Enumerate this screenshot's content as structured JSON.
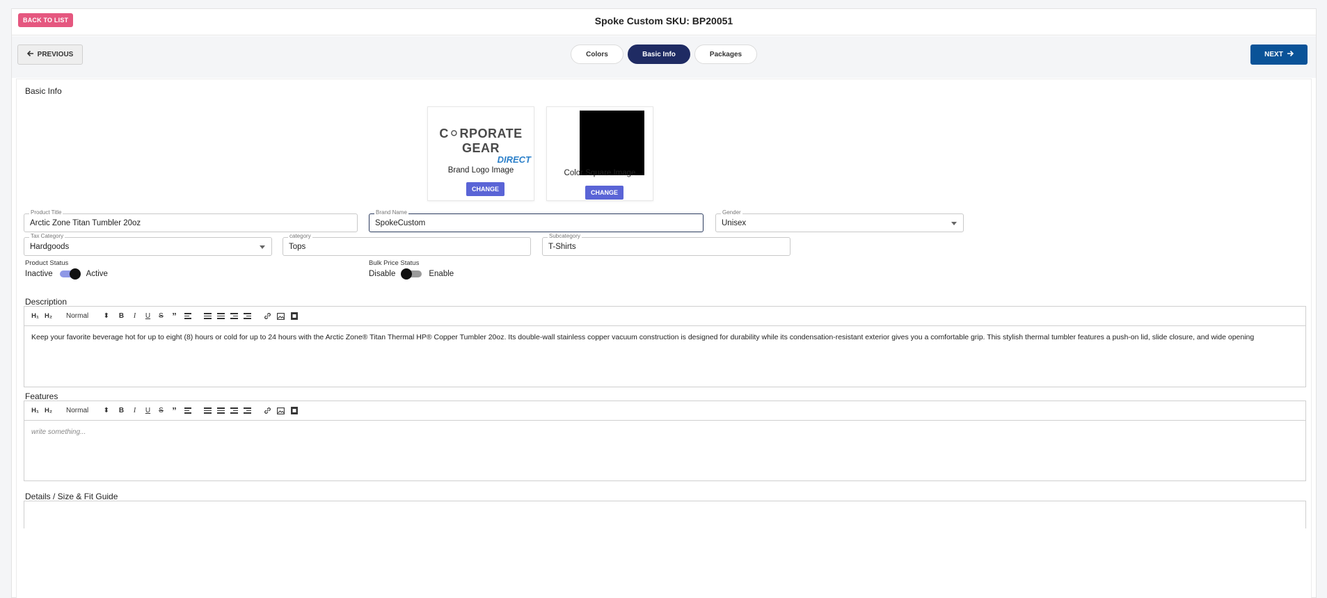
{
  "header": {
    "back_label": "BACK TO LIST",
    "title": "Spoke Custom SKU: BP20051"
  },
  "nav": {
    "previous_label": "PREVIOUS",
    "next_label": "NEXT",
    "tabs": [
      {
        "label": "Colors",
        "active": false
      },
      {
        "label": "Basic Info",
        "active": true
      },
      {
        "label": "Packages",
        "active": false
      }
    ]
  },
  "basic_info": {
    "section_title": "Basic Info",
    "brand_logo": {
      "logo_line1": "C⚪RPORATE GEAR",
      "logo_line2": "DIRECT",
      "caption": "Brand Logo Image",
      "button": "CHANGE"
    },
    "color_square": {
      "swatch_color": "#000000",
      "caption": "Color Square Image",
      "button": "CHANGE"
    },
    "fields": {
      "product_title": {
        "label": "Product Title",
        "value": "Arctic Zone Titan Tumbler 20oz"
      },
      "brand_name": {
        "label": "Brand Name",
        "value": "SpokeCustom"
      },
      "gender": {
        "label": "Gender",
        "value": "Unisex"
      },
      "tax_category": {
        "label": "Tax Category",
        "value": "Hardgoods"
      },
      "category": {
        "label": "category",
        "value": "Tops"
      },
      "subcategory": {
        "label": "Subcategory",
        "value": "T-Shirts"
      }
    },
    "product_status": {
      "label": "Product Status",
      "off_label": "Inactive",
      "on_label": "Active",
      "enabled": true
    },
    "bulk_price_status": {
      "label": "Bulk Price Status",
      "off_label": "Disable",
      "on_label": "Enable",
      "enabled": false
    }
  },
  "editors": {
    "toolbar": {
      "h1": "H₁",
      "h2": "H₂",
      "format": "Normal",
      "bold": "B",
      "italic": "I",
      "underline": "U",
      "strike": "S",
      "quote": "”"
    },
    "description": {
      "label": "Description",
      "text": "Keep your favorite beverage hot for up to eight (8) hours or cold for up to 24 hours with the Arctic Zone® Titan Thermal HP® Copper Tumbler 20oz. Its double-wall stainless copper vacuum construction is designed for durability while its condensation-resistant exterior gives you a comfortable grip. This stylish thermal tumbler features a push-on lid, slide closure, and wide opening"
    },
    "features": {
      "label": "Features",
      "placeholder": "write something..."
    },
    "details": {
      "label": "Details / Size & Fit Guide"
    }
  },
  "colors": {
    "back_button": "#e5577f",
    "next_button": "#0a5398",
    "active_tab": "#1f2b63",
    "change_button": "#5a64d6"
  }
}
